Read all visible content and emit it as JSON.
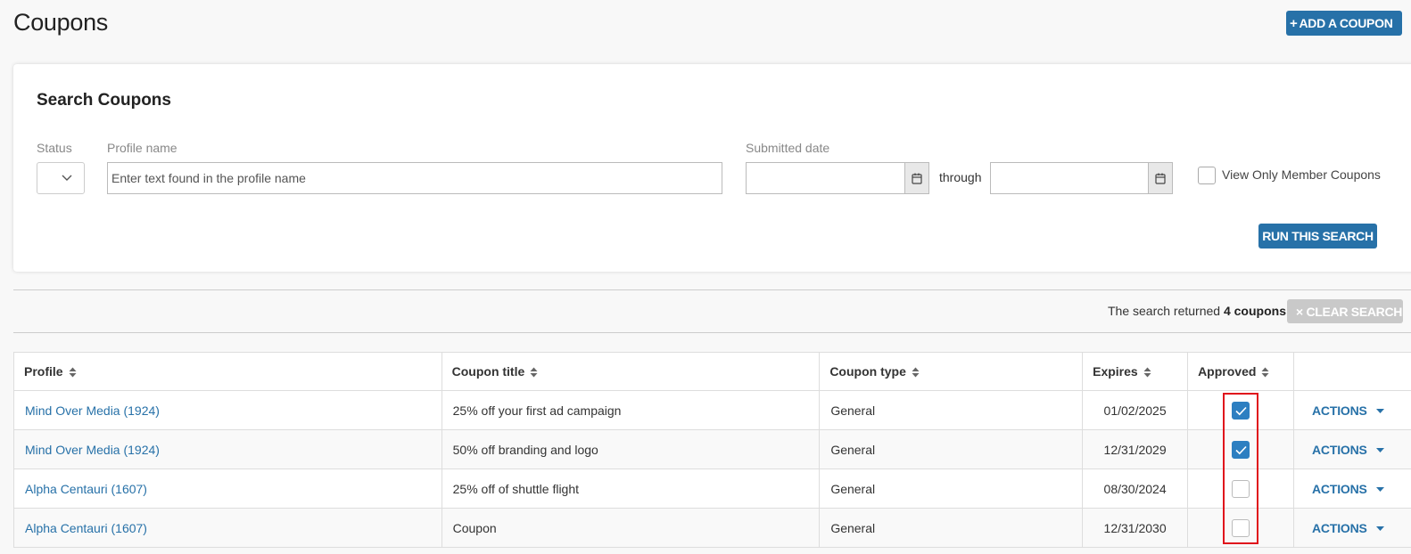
{
  "page": {
    "title": "Coupons",
    "add_button": "ADD A COUPON",
    "add_button_icon": "plus-icon"
  },
  "search": {
    "title": "Search Coupons",
    "status_label": "Status",
    "profile_label": "Profile name",
    "profile_placeholder": "Enter text found in the profile name",
    "date_label": "Submitted date",
    "through_label": "through",
    "member_only_label": "View Only Member Coupons",
    "member_only_checked": false,
    "run_button": "RUN THIS SEARCH"
  },
  "results": {
    "prefix": "The search returned",
    "count_text": "4 coupons",
    "clear_button": "× CLEAR SEARCH"
  },
  "table": {
    "headers": [
      "Profile",
      "Coupon title",
      "Coupon type",
      "Expires",
      "Approved"
    ],
    "rows": [
      {
        "profile": "Mind Over Media (1924)",
        "title": "25% off your first ad campaign",
        "type": "General",
        "expires": "01/02/2025",
        "approved": true,
        "action": "ACTIONS"
      },
      {
        "profile": "Mind Over Media (1924)",
        "title": "50% off branding and logo",
        "type": "General",
        "expires": "12/31/2029",
        "approved": true,
        "action": "ACTIONS"
      },
      {
        "profile": "Alpha Centauri (1607)",
        "title": "25% off of shuttle flight",
        "type": "General",
        "expires": "08/30/2024",
        "approved": false,
        "action": "ACTIONS"
      },
      {
        "profile": "Alpha Centauri (1607)",
        "title": "Coupon",
        "type": "General",
        "expires": "12/31/2030",
        "approved": false,
        "action": "ACTIONS"
      }
    ]
  },
  "colors": {
    "primary": "#2771a8",
    "checkbox_on": "#2d7fc1",
    "highlight": "#e0131c",
    "disabled": "#c9c9c9"
  }
}
